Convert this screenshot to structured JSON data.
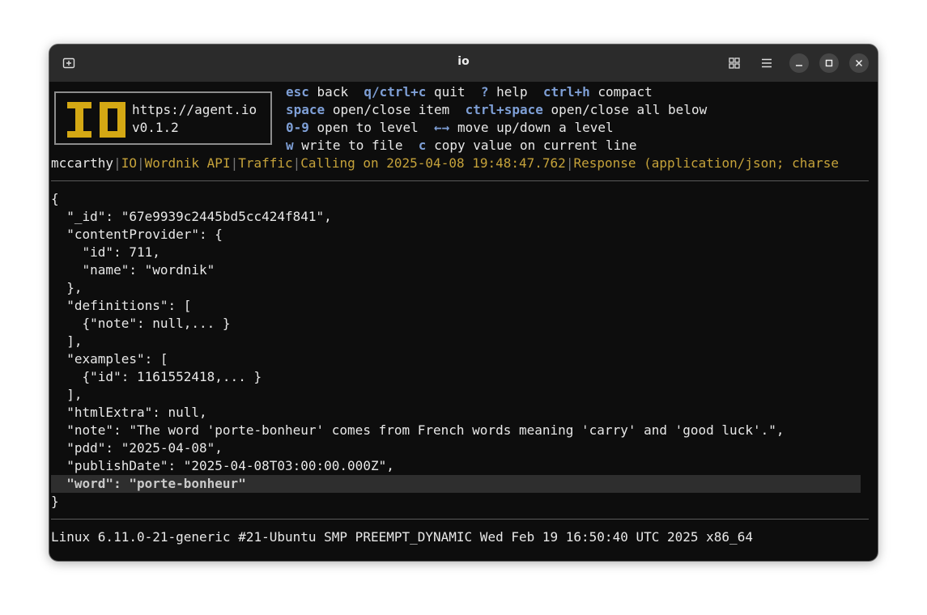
{
  "window": {
    "title": "io"
  },
  "header": {
    "logo_url": "https://agent.io",
    "logo_version": "v0.1.2",
    "help": [
      [
        {
          "key": "esc",
          "desc": "back"
        },
        {
          "key": "q/ctrl+c",
          "desc": "quit"
        },
        {
          "key": "?",
          "desc": "help"
        },
        {
          "key": "ctrl+h",
          "desc": "compact"
        }
      ],
      [
        {
          "key": "space",
          "desc": "open/close item"
        },
        {
          "key": "ctrl+space",
          "desc": "open/close all below"
        }
      ],
      [
        {
          "key": "0-9",
          "desc": "open to level"
        },
        {
          "key": "←→",
          "desc": "move up/down a level"
        }
      ],
      [
        {
          "key": "w",
          "desc": "write to file"
        },
        {
          "key": "c",
          "desc": "copy value on current line"
        }
      ]
    ]
  },
  "breadcrumb": {
    "first": "mccarthy",
    "items": [
      "IO",
      "Wordnik API",
      "Traffic",
      "Calling on 2025-04-08 19:48:47.762",
      "Response (application/json; charse"
    ]
  },
  "json_view": {
    "lines": [
      "{",
      "  \"_id\": \"67e9939c2445bd5cc424f841\",",
      "  \"contentProvider\": {",
      "    \"id\": 711,",
      "    \"name\": \"wordnik\"",
      "  },",
      "  \"definitions\": [",
      "    {\"note\": null,... }",
      "  ],",
      "  \"examples\": [",
      "    {\"id\": 1161552418,... }",
      "  ],",
      "  \"htmlExtra\": null,",
      "  \"note\": \"The word 'porte-bonheur' comes from French words meaning 'carry' and 'good luck'.\",",
      "  \"pdd\": \"2025-04-08\",",
      "  \"publishDate\": \"2025-04-08T03:00:00.000Z\","
    ],
    "selected_line": "  \"word\": \"porte-bonheur\"",
    "closing": "}"
  },
  "status": {
    "text": "Linux 6.11.0-21-generic #21-Ubuntu SMP PREEMPT_DYNAMIC Wed Feb 19 16:50:40 UTC 2025 x86_64"
  },
  "colors": {
    "background": "#0d0d0d",
    "titlebar": "#2b2b2b",
    "key_blue": "#7e9fd6",
    "breadcrumb_gold": "#c5a23a",
    "logo_gold": "#d4a814",
    "highlight": "#2e2e2e"
  }
}
